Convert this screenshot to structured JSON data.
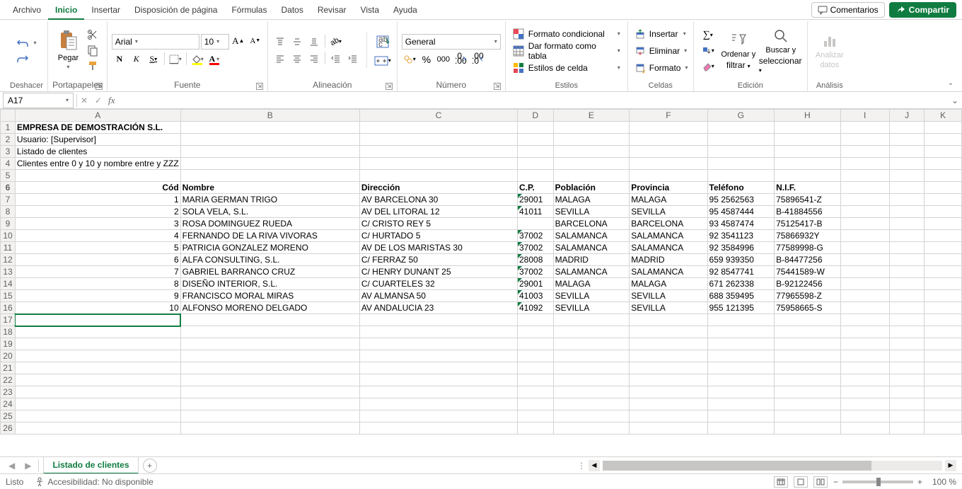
{
  "menu": {
    "archivo": "Archivo",
    "inicio": "Inicio",
    "insertar": "Insertar",
    "disposicion": "Disposición de página",
    "formulas": "Fórmulas",
    "datos": "Datos",
    "revisar": "Revisar",
    "vista": "Vista",
    "ayuda": "Ayuda"
  },
  "topbtn": {
    "comentarios": "Comentarios",
    "compartir": "Compartir"
  },
  "ribbon": {
    "deshacer": "Deshacer",
    "portapapeles": "Portapapeles",
    "pegar": "Pegar",
    "fuente": "Fuente",
    "fontname": "Arial",
    "fontsize": "10",
    "alineacion": "Alineación",
    "numero": "Número",
    "numfmt": "General",
    "estilos": "Estilos",
    "fc": "Formato condicional",
    "dft": "Dar formato como tabla",
    "edc": "Estilos de celda",
    "celdas": "Celdas",
    "insertar": "Insertar",
    "eliminar": "Eliminar",
    "formato": "Formato",
    "edicion": "Edición",
    "ordenar1": "Ordenar y",
    "ordenar2": "filtrar",
    "buscar1": "Buscar y",
    "buscar2": "seleccionar",
    "analisis": "Análisis",
    "analizar1": "Analizar",
    "analizar2": "datos"
  },
  "namebox": "A17",
  "cols": {
    "A": "A",
    "B": "B",
    "C": "C",
    "D": "D",
    "E": "E",
    "F": "F",
    "G": "G",
    "H": "H",
    "I": "I",
    "J": "J",
    "K": "K"
  },
  "widths": {
    "A": 54,
    "B": 278,
    "C": 256,
    "D": 56,
    "E": 120,
    "F": 124,
    "G": 106,
    "H": 102,
    "I": 96,
    "J": 66,
    "K": 70
  },
  "header": {
    "titulo": "EMPRESA DE DEMOSTRACIÓN S.L.",
    "usuario": "Usuario: [Supervisor]",
    "listado": "Listado de clientes",
    "filtro": "Clientes entre 0 y 10 y nombre entre  y ZZZ"
  },
  "colhdr": {
    "cod": "Cód",
    "nombre": "Nombre",
    "direccion": "Dirección",
    "cp": "C.P.",
    "poblacion": "Población",
    "provincia": "Provincia",
    "telefono": "Teléfono",
    "nif": "N.I.F."
  },
  "rows": [
    {
      "cod": "1",
      "nombre": "MARIA GERMAN TRIGO",
      "dir": "AV BARCELONA 30",
      "cp": "29001",
      "gc": true,
      "pob": "MALAGA",
      "prov": "MALAGA",
      "tel": "95 2562563",
      "nif": "75896541-Z"
    },
    {
      "cod": "2",
      "nombre": "SOLA VELA, S.L.",
      "dir": "AV DEL LITORAL 12",
      "cp": "41011",
      "gc": true,
      "pob": "SEVILLA",
      "prov": "SEVILLA",
      "tel": "95 4587444",
      "nif": "B-41884556"
    },
    {
      "cod": "3",
      "nombre": "ROSA DOMINGUEZ RUEDA",
      "dir": "C/ CRISTO REY 5",
      "cp": "",
      "gc": false,
      "pob": "BARCELONA",
      "prov": "BARCELONA",
      "tel": "93 4587474",
      "nif": "75125417-B"
    },
    {
      "cod": "4",
      "nombre": "FERNANDO DE LA RIVA VIVORAS",
      "dir": "C/ HURTADO 5",
      "cp": "37002",
      "gc": true,
      "pob": "SALAMANCA",
      "prov": "SALAMANCA",
      "tel": "92 3541123",
      "nif": "75866932Y"
    },
    {
      "cod": "5",
      "nombre": "PATRICIA GONZALEZ MORENO",
      "dir": "AV DE LOS MARISTAS  30",
      "cp": "37002",
      "gc": true,
      "pob": "SALAMANCA",
      "prov": "SALAMANCA",
      "tel": "92 3584996",
      "nif": "77589998-G"
    },
    {
      "cod": "6",
      "nombre": "ALFA CONSULTING, S.L.",
      "dir": "C/ FERRAZ 50",
      "cp": "28008",
      "gc": true,
      "pob": "MADRID",
      "prov": "MADRID",
      "tel": "659 939350",
      "nif": "B-84477256"
    },
    {
      "cod": "7",
      "nombre": "GABRIEL BARRANCO CRUZ",
      "dir": "C/ HENRY DUNANT 25",
      "cp": "37002",
      "gc": true,
      "pob": "SALAMANCA",
      "prov": "SALAMANCA",
      "tel": "92 8547741",
      "nif": "75441589-W"
    },
    {
      "cod": "8",
      "nombre": "DISEÑO INTERIOR, S.L.",
      "dir": "C/ CUARTELES 32",
      "cp": "29001",
      "gc": true,
      "pob": "MALAGA",
      "prov": "MALAGA",
      "tel": "671 262338",
      "nif": "B-92122456"
    },
    {
      "cod": "9",
      "nombre": "FRANCISCO MORAL MIRAS",
      "dir": "AV ALMANSA 50",
      "cp": "41003",
      "gc": true,
      "pob": "SEVILLA",
      "prov": "SEVILLA",
      "tel": "688 359495",
      "nif": "77965598-Z"
    },
    {
      "cod": "10",
      "nombre": "ALFONSO MORENO DELGADO",
      "dir": "AV ANDALUCIA 23",
      "cp": "41092",
      "gc": true,
      "pob": "SEVILLA",
      "prov": "SEVILLA",
      "tel": "955 121395",
      "nif": "75958665-S"
    }
  ],
  "sheet": "Listado de clientes",
  "status": {
    "listo": "Listo",
    "acc": "Accesibilidad: No disponible",
    "zoom": "100 %"
  }
}
